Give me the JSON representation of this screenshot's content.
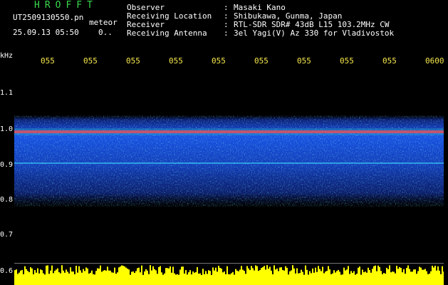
{
  "header": {
    "app_title": "HROFFT",
    "filename": "UT2509130550.pn",
    "mode": "meteor",
    "datetime": "25.09.13 05:50",
    "status": "0..",
    "info": [
      {
        "label": "Observer",
        "value": "Masaki Kano"
      },
      {
        "label": "Receiving Location",
        "value": "Shibukawa, Gunma, Japan"
      },
      {
        "label": "Receiver",
        "value": "RTL-SDR SDR# 43dB L15 103.2MHz CW"
      },
      {
        "label": "Receiving Antenna",
        "value": "3el Yagi(V) Az 330 for Vladivostok"
      }
    ]
  },
  "axes": {
    "y_unit": "kHz",
    "y_ticks": [
      "1.1",
      "1.0",
      "0.9",
      "0.8",
      "0.7",
      "0.6"
    ],
    "x_ticks": [
      "055",
      "055",
      "055",
      "055",
      "055",
      "055",
      "055",
      "055",
      "055",
      "0600"
    ]
  },
  "colors": {
    "title": "#3ad94a",
    "x_ticks": "#f6e84a",
    "noise_band": "#1b5cff",
    "carrier": "#ff2a55",
    "level_bar": "#ffff00"
  }
}
